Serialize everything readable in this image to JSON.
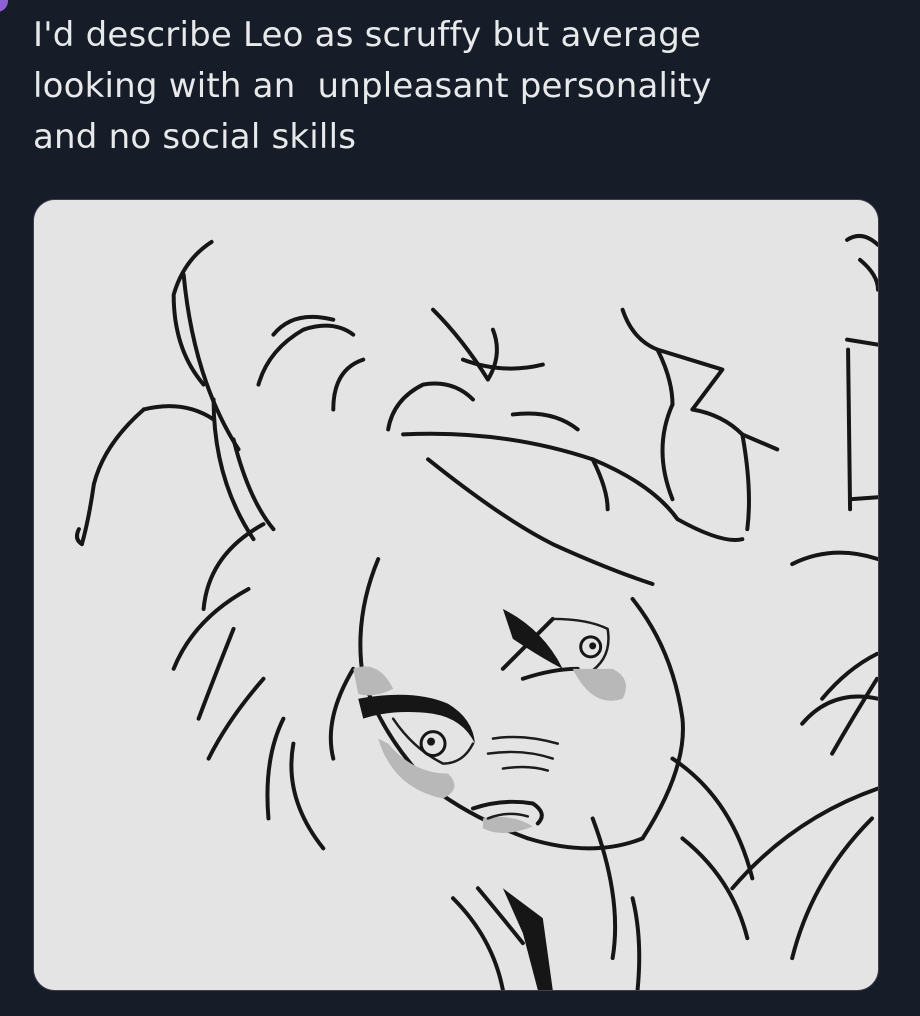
{
  "tweet": {
    "text": "I'd describe Leo as scruffy but average\nlooking with an  unpleasant personality\nand no social skills"
  },
  "media": {
    "type": "image",
    "description_icon": "sketch-illustration"
  },
  "colors": {
    "background": "#161d28",
    "text": "#e7e9ea",
    "media_background": "#e3e3e3",
    "avatar_accent": "#8f5fd6"
  }
}
